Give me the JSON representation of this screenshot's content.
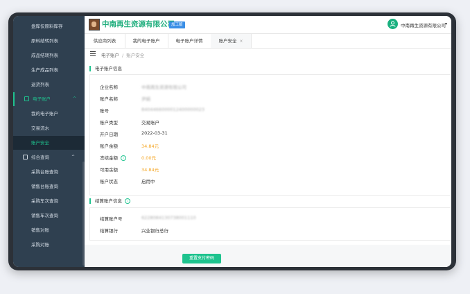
{
  "header": {
    "company_name": "中南再生资源有限公司",
    "badge": "加工版",
    "user_name": "中南再生资源有限公司",
    "user_caret": "▾"
  },
  "sidebar": {
    "items": [
      {
        "label": "盘库仅原料库存",
        "type": "item"
      },
      {
        "label": "原料结转列表",
        "type": "item"
      },
      {
        "label": "成品结转列表",
        "type": "item"
      },
      {
        "label": "生产成品列表",
        "type": "item"
      },
      {
        "label": "退货列表",
        "type": "item"
      },
      {
        "label": "电子账户",
        "type": "group",
        "chevron": "^"
      },
      {
        "label": "我的电子账户",
        "type": "item"
      },
      {
        "label": "交易流水",
        "type": "item"
      },
      {
        "label": "账户安全",
        "type": "item",
        "active": true
      },
      {
        "label": "综合查询",
        "type": "group",
        "chevron": "^"
      },
      {
        "label": "采购台账查询",
        "type": "item"
      },
      {
        "label": "销售台账查询",
        "type": "item"
      },
      {
        "label": "采购车次查询",
        "type": "item"
      },
      {
        "label": "销售车次查询",
        "type": "item"
      },
      {
        "label": "销售对账",
        "type": "item"
      },
      {
        "label": "采购对账",
        "type": "item"
      }
    ]
  },
  "tabs": [
    {
      "label": "供应商列表"
    },
    {
      "label": "我的电子账户"
    },
    {
      "label": "电子账户详情"
    },
    {
      "label": "账户安全",
      "active": true,
      "close": "×"
    }
  ],
  "breadcrumb": {
    "parent": "电子账户",
    "sep": "/",
    "current": "账户安全"
  },
  "account_section": {
    "title": "电子账户信息",
    "rows": [
      {
        "label": "企业名称",
        "value": "中南再生资源有限公司",
        "blurred": true
      },
      {
        "label": "账户名称",
        "value": "尹娟",
        "blurred": true
      },
      {
        "label": "账号",
        "value": "8404466000012400000023",
        "blurred": true
      },
      {
        "label": "账户类型",
        "value": "交易账户"
      },
      {
        "label": "开户日期",
        "value": "2022-03-31"
      },
      {
        "label": "账户余额",
        "value": "34.84元",
        "highlight": true
      },
      {
        "label": "冻结金额",
        "value": "0.00元",
        "highlight": true,
        "info": "i"
      },
      {
        "label": "可用余额",
        "value": "34.84元",
        "highlight": true
      },
      {
        "label": "账户状态",
        "value": "启用中"
      }
    ]
  },
  "settle_section": {
    "title": "结算账户信息",
    "info": "i",
    "rows": [
      {
        "label": "结算账户号",
        "value": "6228084130738001110",
        "blurred": true
      },
      {
        "label": "结算银行",
        "value": "兴业银行总行"
      }
    ]
  },
  "reset_button": "重置支付密码",
  "colors": {
    "accent": "#1fc38f",
    "sidebar": "#2f4050",
    "orange": "#f5a623",
    "badge": "#3a8ee6"
  }
}
